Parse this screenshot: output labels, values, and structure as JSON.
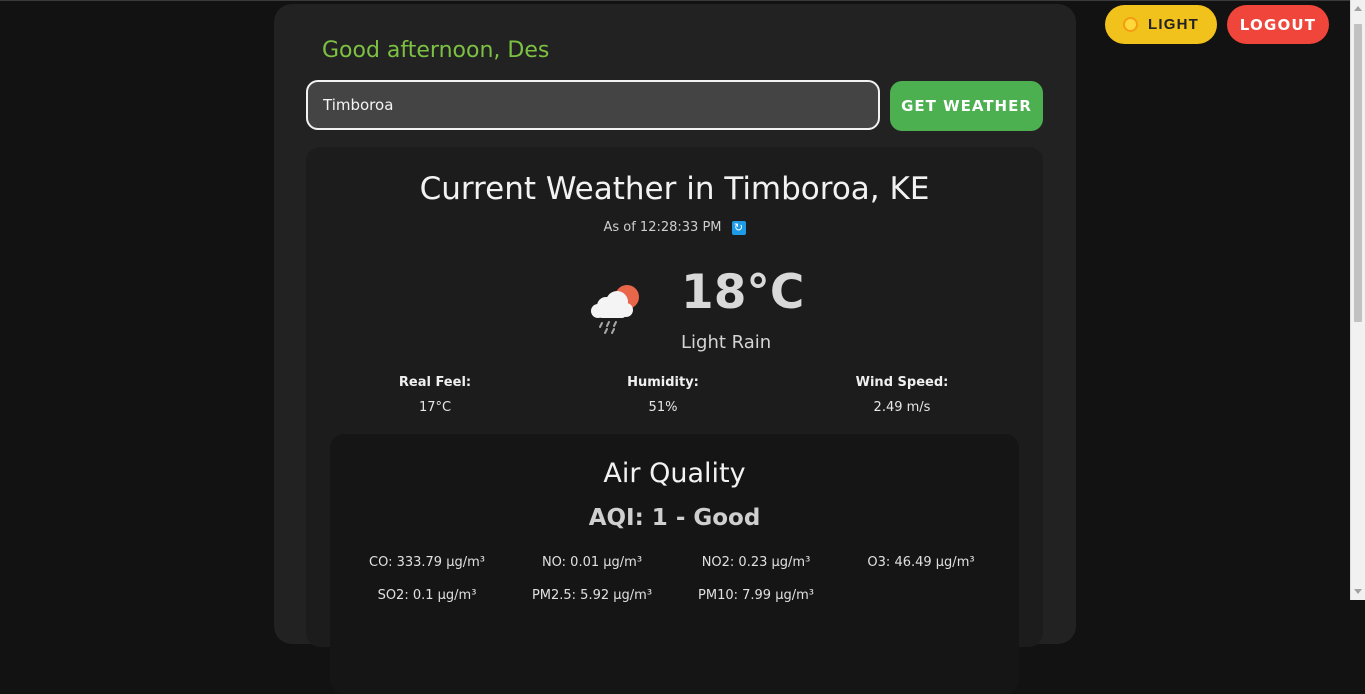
{
  "header": {
    "theme_toggle_label": "LIGHT",
    "logout_label": "LOGOUT",
    "theme_color": "#f1c21b",
    "logout_color": "#f0453a"
  },
  "greeting": "Good afternoon, Des",
  "search": {
    "value": "Timboroa",
    "button_label": "GET WEATHER",
    "button_color": "#4caf50"
  },
  "weather": {
    "title": "Current Weather in Timboroa, KE",
    "as_of": "As of 12:28:33 PM",
    "refresh_icon": "refresh-icon",
    "condition_icon": "cloud-sun-rain-icon",
    "temperature": "18°C",
    "description": "Light Rain",
    "stats": [
      {
        "label": "Real Feel:",
        "value": "17°C"
      },
      {
        "label": "Humidity:",
        "value": "51%"
      },
      {
        "label": "Wind Speed:",
        "value": "2.49 m/s"
      }
    ]
  },
  "air_quality": {
    "title": "Air Quality",
    "aqi": "AQI: 1 - Good",
    "pollutants": [
      {
        "label": "CO: 333.79 µg/m³"
      },
      {
        "label": "NO: 0.01 µg/m³"
      },
      {
        "label": "NO2: 0.23 µg/m³"
      },
      {
        "label": "O3: 46.49 µg/m³"
      },
      {
        "label": "SO2: 0.1 µg/m³"
      },
      {
        "label": "PM2.5: 5.92 µg/m³"
      },
      {
        "label": "PM10: 7.99 µg/m³"
      }
    ]
  }
}
